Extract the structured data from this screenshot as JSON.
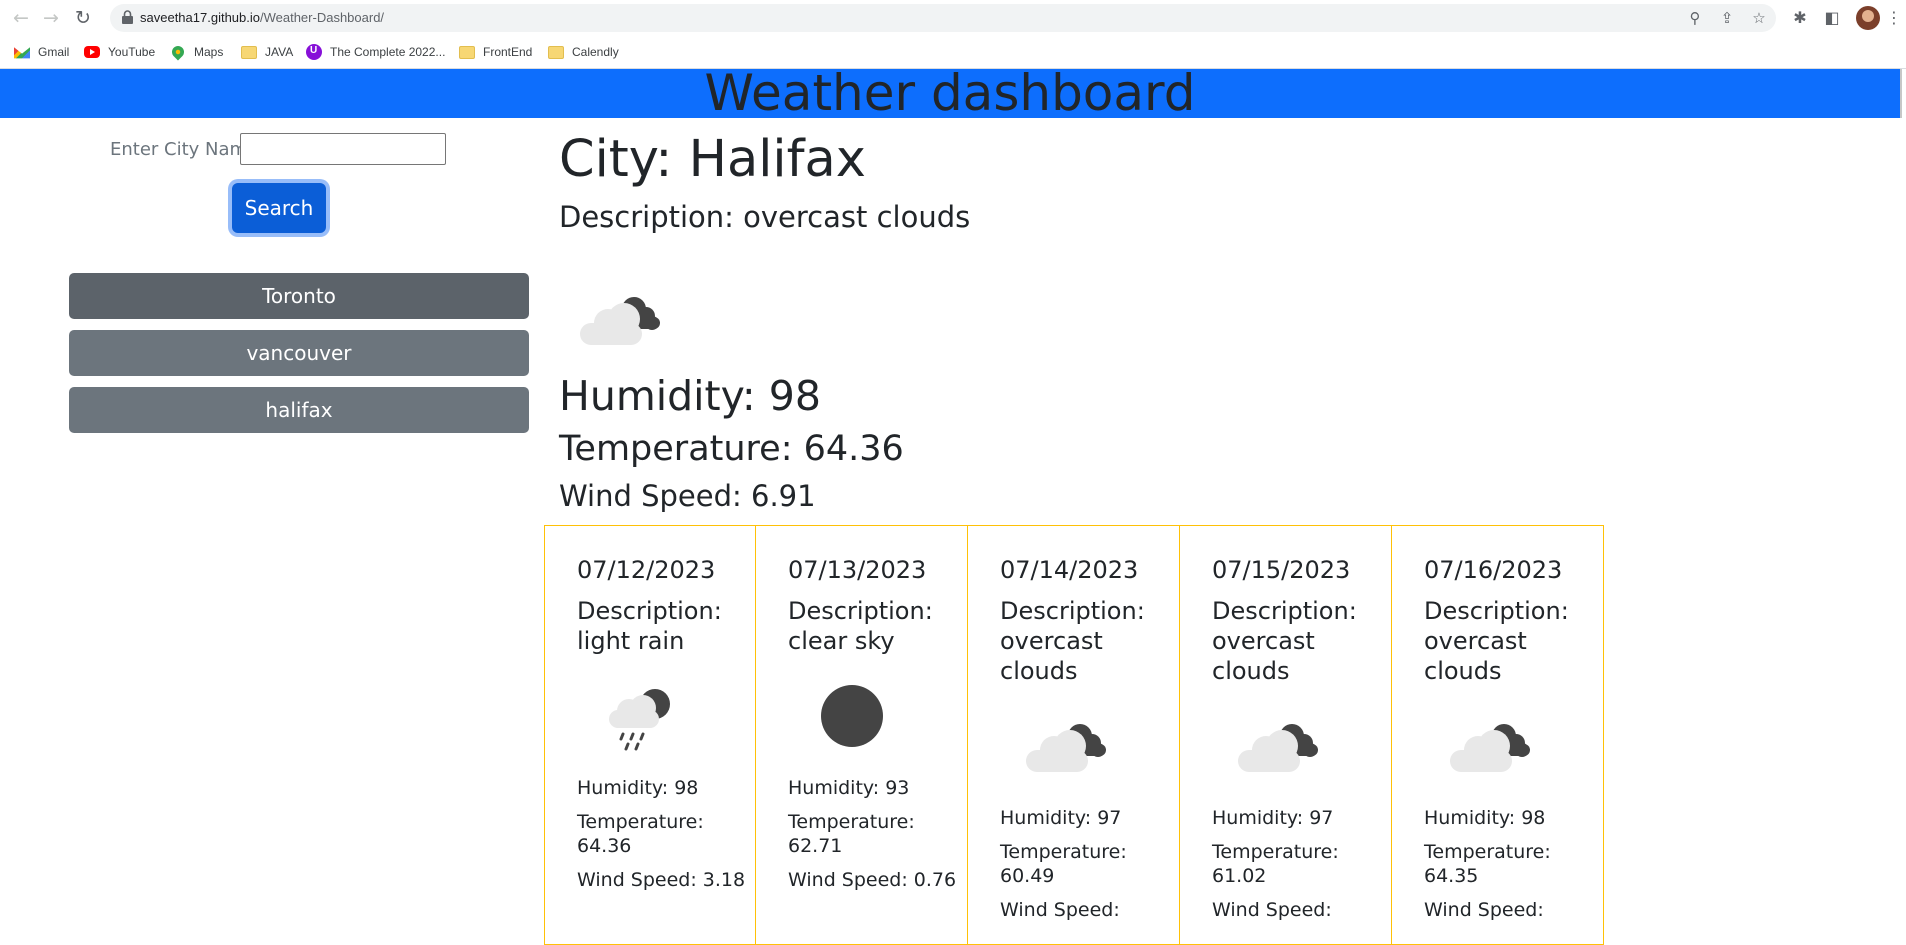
{
  "browser": {
    "url_host": "saveetha17.github.io",
    "url_path": "/Weather-Dashboard/",
    "bookmarks": [
      "Gmail",
      "YouTube",
      "Maps",
      "JAVA",
      "The Complete 2022...",
      "FrontEnd",
      "Calendly"
    ]
  },
  "header": {
    "title": "Weather dashboard"
  },
  "search": {
    "label": "Enter City Name",
    "value": "",
    "button": "Search"
  },
  "history": [
    "Toronto",
    "vancouver",
    "halifax"
  ],
  "current": {
    "city": "City: Halifax",
    "description": "Description: overcast clouds",
    "icon": "overcast-clouds-icon",
    "humidity": "Humidity: 98",
    "temperature": "Temperature: 64.36",
    "wind": "Wind Speed: 6.91"
  },
  "forecast": [
    {
      "date": "07/12/2023",
      "description": "Description: light rain",
      "icon": "light-rain-icon",
      "humidity": "Humidity: 98",
      "temperature": "Temperature: 64.36",
      "wind": "Wind Speed: 3.18"
    },
    {
      "date": "07/13/2023",
      "description": "Description: clear sky",
      "icon": "clear-sky-icon",
      "humidity": "Humidity: 93",
      "temperature": "Temperature: 62.71",
      "wind": "Wind Speed: 0.76"
    },
    {
      "date": "07/14/2023",
      "description": "Description: overcast clouds",
      "icon": "overcast-clouds-icon",
      "humidity": "Humidity: 97",
      "temperature": "Temperature: 60.49",
      "wind": "Wind Speed:"
    },
    {
      "date": "07/15/2023",
      "description": "Description: overcast clouds",
      "icon": "overcast-clouds-icon",
      "humidity": "Humidity: 97",
      "temperature": "Temperature: 61.02",
      "wind": "Wind Speed:"
    },
    {
      "date": "07/16/2023",
      "description": "Description: overcast clouds",
      "icon": "overcast-clouds-icon",
      "humidity": "Humidity: 98",
      "temperature": "Temperature: 64.35",
      "wind": "Wind Speed:"
    }
  ],
  "colors": {
    "header": "#0d6efd",
    "history_button": "#6c757d",
    "card_border": "#ffc107",
    "search_button": "#0b5ed7"
  }
}
